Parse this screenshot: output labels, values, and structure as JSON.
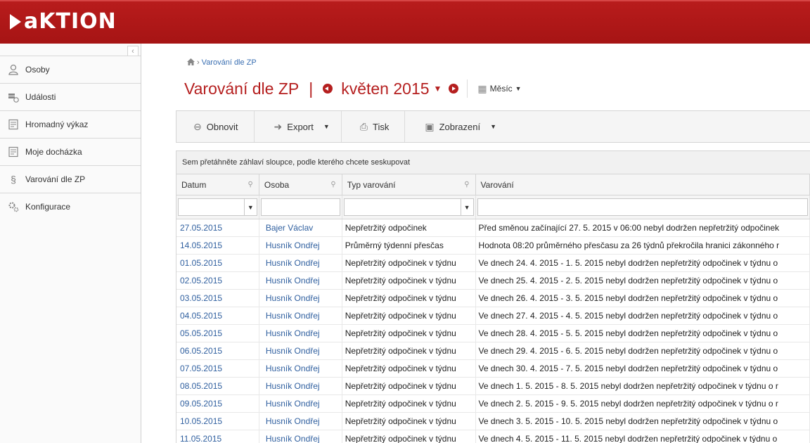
{
  "app": {
    "logo_text": "aKTION"
  },
  "sidebar": {
    "collapse_glyph": "‹",
    "items": [
      {
        "label": "Osoby",
        "icon": "person-icon"
      },
      {
        "label": "Události",
        "icon": "events-icon"
      },
      {
        "label": "Hromadný výkaz",
        "icon": "report-icon"
      },
      {
        "label": "Moje docházka",
        "icon": "attendance-icon"
      },
      {
        "label": "Varování dle ZP",
        "icon": "paragraph-icon"
      },
      {
        "label": "Konfigurace",
        "icon": "gears-icon"
      }
    ]
  },
  "breadcrumb": {
    "current": "Varování dle ZP"
  },
  "header": {
    "title": "Varování dle ZP",
    "separator": "|",
    "month": "květen 2015",
    "view_label": "Měsíc"
  },
  "toolbar": {
    "refresh": "Obnovit",
    "export": "Export",
    "print": "Tisk",
    "display": "Zobrazení"
  },
  "grid": {
    "group_hint": "Sem přetáhněte záhlaví sloupce, podle kterého chcete seskupovat",
    "columns": [
      "Datum",
      "Osoba",
      "Typ varování",
      "Varování"
    ],
    "rows": [
      [
        "27.05.2015",
        "Bajer Václav",
        "Nepřetržitý odpočinek",
        "Před směnou začínající 27. 5. 2015 v 06:00 nebyl dodržen nepřetržitý odpočinek"
      ],
      [
        "14.05.2015",
        "Husník Ondřej",
        "Průměrný týdenní přesčas",
        "Hodnota 08:20 průměrného přesčasu za 26 týdnů překročila hranici zákonného r"
      ],
      [
        "01.05.2015",
        "Husník Ondřej",
        "Nepřetržitý odpočinek v týdnu",
        "Ve dnech 24. 4. 2015 - 1. 5. 2015 nebyl dodržen nepřetržitý odpočinek v týdnu o"
      ],
      [
        "02.05.2015",
        "Husník Ondřej",
        "Nepřetržitý odpočinek v týdnu",
        "Ve dnech 25. 4. 2015 - 2. 5. 2015 nebyl dodržen nepřetržitý odpočinek v týdnu o"
      ],
      [
        "03.05.2015",
        "Husník Ondřej",
        "Nepřetržitý odpočinek v týdnu",
        "Ve dnech 26. 4. 2015 - 3. 5. 2015 nebyl dodržen nepřetržitý odpočinek v týdnu o"
      ],
      [
        "04.05.2015",
        "Husník Ondřej",
        "Nepřetržitý odpočinek v týdnu",
        "Ve dnech 27. 4. 2015 - 4. 5. 2015 nebyl dodržen nepřetržitý odpočinek v týdnu o"
      ],
      [
        "05.05.2015",
        "Husník Ondřej",
        "Nepřetržitý odpočinek v týdnu",
        "Ve dnech 28. 4. 2015 - 5. 5. 2015 nebyl dodržen nepřetržitý odpočinek v týdnu o"
      ],
      [
        "06.05.2015",
        "Husník Ondřej",
        "Nepřetržitý odpočinek v týdnu",
        "Ve dnech 29. 4. 2015 - 6. 5. 2015 nebyl dodržen nepřetržitý odpočinek v týdnu o"
      ],
      [
        "07.05.2015",
        "Husník Ondřej",
        "Nepřetržitý odpočinek v týdnu",
        "Ve dnech 30. 4. 2015 - 7. 5. 2015 nebyl dodržen nepřetržitý odpočinek v týdnu o"
      ],
      [
        "08.05.2015",
        "Husník Ondřej",
        "Nepřetržitý odpočinek v týdnu",
        "Ve dnech 1. 5. 2015 - 8. 5. 2015 nebyl dodržen nepřetržitý odpočinek v týdnu o r"
      ],
      [
        "09.05.2015",
        "Husník Ondřej",
        "Nepřetržitý odpočinek v týdnu",
        "Ve dnech 2. 5. 2015 - 9. 5. 2015 nebyl dodržen nepřetržitý odpočinek v týdnu o r"
      ],
      [
        "10.05.2015",
        "Husník Ondřej",
        "Nepřetržitý odpočinek v týdnu",
        "Ve dnech 3. 5. 2015 - 10. 5. 2015 nebyl dodržen nepřetržitý odpočinek v týdnu o"
      ],
      [
        "11.05.2015",
        "Husník Ondřej",
        "Nepřetržitý odpočinek v týdnu",
        "Ve dnech 4. 5. 2015 - 11. 5. 2015 nebyl dodržen nepřetržitý odpočinek v týdnu o"
      ]
    ]
  },
  "colors": {
    "brand": "#b51f1f",
    "link": "#2f5f9f"
  }
}
